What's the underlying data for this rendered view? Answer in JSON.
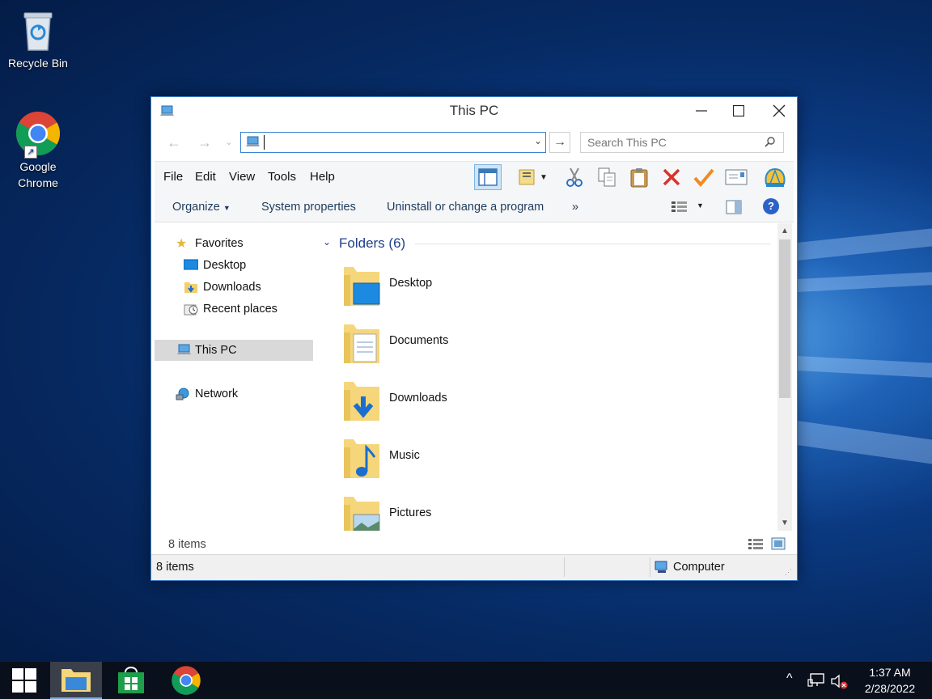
{
  "desktop": {
    "icons": [
      {
        "label": "Recycle Bin",
        "icon": "recycle-bin-icon"
      },
      {
        "label": "Google\nChrome",
        "icon": "chrome-icon"
      }
    ]
  },
  "window": {
    "title": "This PC",
    "address_value": "",
    "search_placeholder": "Search This PC",
    "menu": [
      "File",
      "Edit",
      "View",
      "Tools",
      "Help"
    ],
    "commands": {
      "organize": "Organize",
      "system_properties": "System properties",
      "uninstall": "Uninstall or change a program",
      "more": "»"
    },
    "nav": {
      "favorites": "Favorites",
      "desktop": "Desktop",
      "downloads": "Downloads",
      "recent": "Recent places",
      "this_pc": "This PC",
      "network": "Network"
    },
    "group_header": "Folders (6)",
    "folders": [
      {
        "label": "Desktop"
      },
      {
        "label": "Documents"
      },
      {
        "label": "Downloads"
      },
      {
        "label": "Music"
      },
      {
        "label": "Pictures"
      }
    ],
    "inner_status": "8 items",
    "status_items": "8 items",
    "status_location": "Computer"
  },
  "taskbar": {
    "time": "1:37 AM",
    "date": "2/28/2022"
  },
  "colors": {
    "accent": "#3b83d4",
    "selection": "#d9d9d9",
    "group_header": "#1e3f8a",
    "taskbar": "#0a0f1c"
  }
}
